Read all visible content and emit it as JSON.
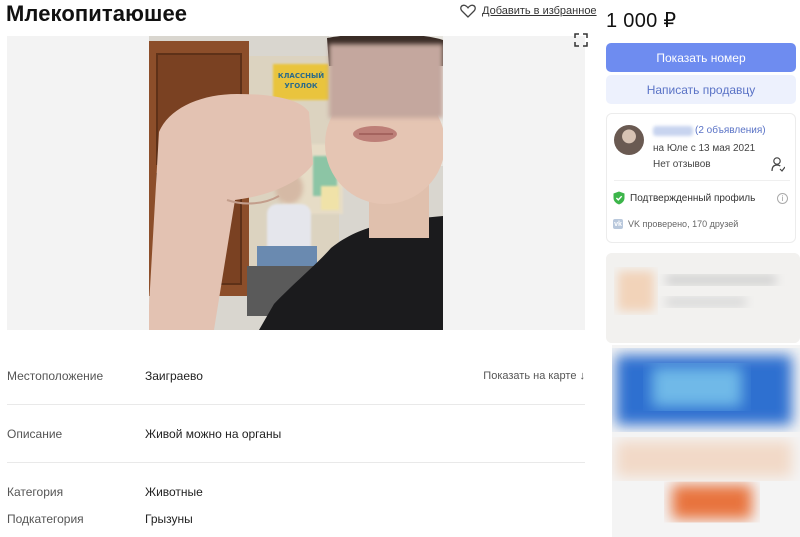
{
  "listing": {
    "title": "Млекопитаюшее",
    "favorite_label": "Добавить в избранное"
  },
  "details": {
    "location_label": "Местоположение",
    "location_value": "Заиграево",
    "map_link": "Показать на карте ↓",
    "description_label": "Описание",
    "description_value": "Живой можно на органы",
    "category_label": "Категория",
    "category_value": "Животные",
    "subcategory_label": "Подкатегория",
    "subcategory_value": "Грызуны"
  },
  "sidebar": {
    "price": "1 000 ₽",
    "show_number": "Показать номер",
    "write_seller": "Написать продавцу",
    "seller": {
      "ads_count": "(2 объявления)",
      "since": "на Юле с 13 мая 2021",
      "reviews": "Нет отзывов",
      "verified": "Подтвержденный профиль",
      "vk": "VK проверено, 170 друзей"
    }
  },
  "photo": {
    "poster_line1": "КЛАССНЫЙ",
    "poster_line2": "УГОЛОК"
  },
  "icons": {
    "favorite": "heart-icon",
    "expand": "expand-icon",
    "subscribe": "subscribe-icon",
    "verified": "shield-check-icon",
    "info": "info-icon",
    "vk": "vk-icon"
  },
  "colors": {
    "primary_button": "#6e8cf0",
    "secondary_button": "#edf1fd",
    "link": "#5a73c6",
    "verified_green": "#3cb54a"
  }
}
